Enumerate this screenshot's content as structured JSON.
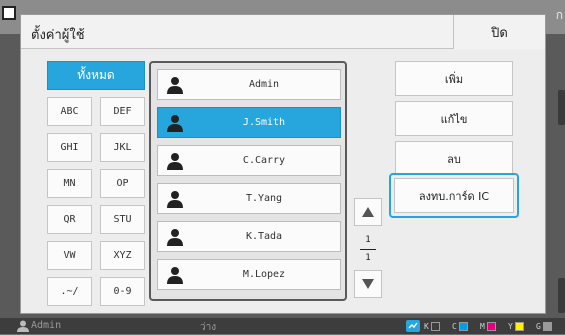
{
  "background": {
    "ghost_text": "ก"
  },
  "dialog": {
    "title": "ตั้งค่าผู้ใช้",
    "close_label": "ปิด"
  },
  "filters": {
    "all_label": "ทั้งหมด",
    "items": [
      "ABC",
      "DEF",
      "GHI",
      "JKL",
      "MN",
      "OP",
      "QR",
      "STU",
      "VW",
      "XYZ",
      ".~/",
      "0-9"
    ]
  },
  "users": [
    {
      "name": "Admin",
      "selected": false
    },
    {
      "name": "J.Smith",
      "selected": true
    },
    {
      "name": "C.Carry",
      "selected": false
    },
    {
      "name": "T.Yang",
      "selected": false
    },
    {
      "name": "K.Tada",
      "selected": false
    },
    {
      "name": "M.Lopez",
      "selected": false
    }
  ],
  "pagination": {
    "current": "1",
    "total": "1"
  },
  "actions": {
    "add_label": "เพิ่ม",
    "edit_label": "แก้ไข",
    "delete_label": "ลบ",
    "ic_label": "ลงทบ.การ์ด IC"
  },
  "status": {
    "user": "Admin",
    "state": "ว่าง",
    "ink": [
      {
        "label": "K",
        "color": "#000000"
      },
      {
        "label": "C",
        "color": "#00a0e9"
      },
      {
        "label": "M",
        "color": "#e4007f"
      },
      {
        "label": "Y",
        "color": "#fff100"
      },
      {
        "label": "G",
        "color": "#9a9a9a"
      }
    ]
  },
  "colors": {
    "accent": "#27a5dd",
    "dialog_bg": "#ededed",
    "status_bg": "#3d3d3d"
  }
}
